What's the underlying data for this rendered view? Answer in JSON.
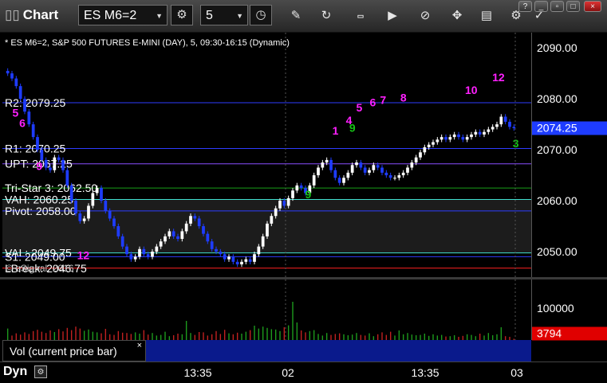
{
  "toolbar": {
    "title": "Chart",
    "symbol": "ES M6=2",
    "interval": "5"
  },
  "chart": {
    "header": "* ES M6=2, S&P 500 FUTURES E-MINI (DAY), 5, 09:30-16:15 (Dynamic)",
    "watermark": "© eSignal, 2016",
    "current_price_label": "2074.25",
    "current_volume_label": "3794",
    "volume_tab_label": "Vol (current price bar)",
    "volume_tab_close": "×",
    "status_label": "Dyn"
  },
  "colors": {
    "up_candle": "#ffffff",
    "down_candle": "#1e3cff",
    "level_cyan": "#40e0d0",
    "level_blue": "#2e3cff",
    "level_red": "#ff2020",
    "level_green": "#18a018",
    "level_purple": "#8a4fff",
    "magenta": "#ff20ff",
    "green_count": "#16c016",
    "volume_up": "#1d9a1d",
    "volume_down": "#c02020"
  },
  "chart_data": [
    {
      "type": "candlestick",
      "ylim": [
        2045,
        2093
      ],
      "yticks": [
        2050,
        2060,
        2070,
        2080,
        2090
      ],
      "ytick_labels": [
        "2050.00",
        "2060.00",
        "2070.00",
        "2080.00",
        "2090.00"
      ],
      "xticks": [
        "13:35",
        "02",
        "13:35",
        "03"
      ],
      "levels": [
        {
          "label": "R2: 2079.25",
          "value": 2079.25,
          "color": "level_blue"
        },
        {
          "label": "R1: 2070.25",
          "value": 2070.25,
          "color": "level_blue"
        },
        {
          "label": "UPT: 2067.25",
          "value": 2067.25,
          "color": "level_purple"
        },
        {
          "label": "Tri-Star 3: 2062.50",
          "value": 2062.5,
          "color": "level_green"
        },
        {
          "label": "VAH: 2060.25",
          "value": 2060.25,
          "color": "level_cyan"
        },
        {
          "label": "Pivot: 2058.00",
          "value": 2058.0,
          "color": "level_blue"
        },
        {
          "label": "VAL: 2049.75",
          "value": 2049.75,
          "color": "level_cyan"
        },
        {
          "label": "S1: 2049.00",
          "value": 2049.0,
          "color": "level_blue"
        },
        {
          "label": "LBreak: 2046.75",
          "value": 2046.75,
          "color": "level_red"
        }
      ],
      "closes": [
        2085.0,
        2084.0,
        2082.5,
        2080.0,
        2077.5,
        2075.0,
        2072.5,
        2070.0,
        2068.0,
        2066.5,
        2066.0,
        2068.5,
        2068.0,
        2066.0,
        2063.0,
        2060.0,
        2057.5,
        2056.0,
        2056.5,
        2059.0,
        2061.5,
        2062.5,
        2060.0,
        2058.0,
        2056.5,
        2055.0,
        2053.0,
        2051.0,
        2049.5,
        2048.5,
        2049.0,
        2050.5,
        2049.5,
        2049.0,
        2050.0,
        2051.0,
        2052.0,
        2053.0,
        2054.0,
        2053.0,
        2052.5,
        2054.0,
        2055.5,
        2057.0,
        2056.5,
        2055.0,
        2053.5,
        2052.0,
        2050.5,
        2050.0,
        2049.5,
        2048.5,
        2049.0,
        2048.0,
        2047.5,
        2048.0,
        2048.5,
        2048.0,
        2049.5,
        2051.0,
        2053.0,
        2055.5,
        2057.0,
        2058.5,
        2060.0,
        2059.0,
        2060.5,
        2062.0,
        2063.0,
        2062.5,
        2061.5,
        2063.0,
        2065.0,
        2066.5,
        2067.5,
        2068.0,
        2066.0,
        2064.5,
        2063.5,
        2064.5,
        2065.5,
        2067.0,
        2067.5,
        2066.5,
        2065.5,
        2066.0,
        2067.0,
        2066.5,
        2065.5,
        2065.0,
        2064.5,
        2064.5,
        2065.0,
        2065.5,
        2066.5,
        2067.5,
        2068.5,
        2069.5,
        2070.5,
        2071.0,
        2071.5,
        2072.0,
        2072.5,
        2072.0,
        2072.5,
        2073.0,
        2072.5,
        2072.0,
        2072.5,
        2073.0,
        2073.5,
        2073.0,
        2073.5,
        2074.0,
        2074.5,
        2075.0,
        2076.5,
        2075.5,
        2074.5,
        2074.25
      ],
      "volume_ylim": [
        0,
        190000
      ],
      "volume_tick": 100000,
      "volume_tick_label": "100000",
      "volumes": [
        36000,
        14000,
        21000,
        17000,
        24000,
        19000,
        28000,
        32000,
        26000,
        22000,
        30000,
        25000,
        34000,
        27000,
        38000,
        31000,
        42000,
        36000,
        29000,
        33000,
        26000,
        24000,
        21000,
        35000,
        18000,
        16000,
        28000,
        23000,
        22000,
        19000,
        24000,
        20000,
        31000,
        17000,
        22000,
        14000,
        16000,
        26000,
        12000,
        15000,
        20000,
        18000,
        60000,
        22000,
        16000,
        25000,
        24000,
        14000,
        18000,
        28000,
        19000,
        32000,
        21000,
        18000,
        23000,
        20000,
        26000,
        31000,
        45000,
        36000,
        42000,
        38000,
        34000,
        33000,
        28000,
        40000,
        46000,
        120000,
        55000,
        30000,
        24000,
        28000,
        31000,
        19000,
        14000,
        22000,
        16000,
        19000,
        21000,
        18000,
        15000,
        17000,
        22000,
        16000,
        14000,
        21000,
        12000,
        18000,
        24000,
        16000,
        26000,
        14000,
        30000,
        18000,
        22000,
        17000,
        15000,
        16000,
        20000,
        13000,
        18000,
        14000,
        16000,
        11000,
        12000,
        15000,
        10000,
        13000,
        18000,
        16000,
        12000,
        20000,
        14000,
        22000,
        15000,
        18000,
        40000,
        12000,
        10000,
        3794
      ],
      "count_markers": [
        {
          "text": "5",
          "index": 2,
          "value": 2076.5,
          "color": "magenta"
        },
        {
          "text": "6",
          "index": 4,
          "value": 2074.5,
          "color": "magenta"
        },
        {
          "text": "9",
          "index": 9,
          "value": 2066.0,
          "color": "magenta"
        },
        {
          "text": "12",
          "index": 21,
          "value": 2048.5,
          "color": "magenta"
        },
        {
          "text": "9",
          "index": 88,
          "value": 2060.5,
          "color": "green_count"
        },
        {
          "text": "1",
          "index": 96,
          "value": 2073.0,
          "color": "magenta"
        },
        {
          "text": "4",
          "index": 100,
          "value": 2075.0,
          "color": "magenta"
        },
        {
          "text": "9",
          "index": 101,
          "value": 2073.5,
          "color": "green_count"
        },
        {
          "text": "5",
          "index": 103,
          "value": 2077.5,
          "color": "magenta"
        },
        {
          "text": "6",
          "index": 107,
          "value": 2078.5,
          "color": "magenta"
        },
        {
          "text": "7",
          "index": 110,
          "value": 2079.0,
          "color": "magenta"
        },
        {
          "text": "8",
          "index": 116,
          "value": 2079.5,
          "color": "magenta"
        },
        {
          "text": "10",
          "index": 135,
          "value": 2081.0,
          "color": "magenta"
        },
        {
          "text": "12",
          "index": 143,
          "value": 2083.5,
          "color": "magenta"
        },
        {
          "text": "3",
          "index": 149,
          "value": 2070.5,
          "color": "green_count"
        }
      ],
      "marker_index_total": 150
    }
  ]
}
